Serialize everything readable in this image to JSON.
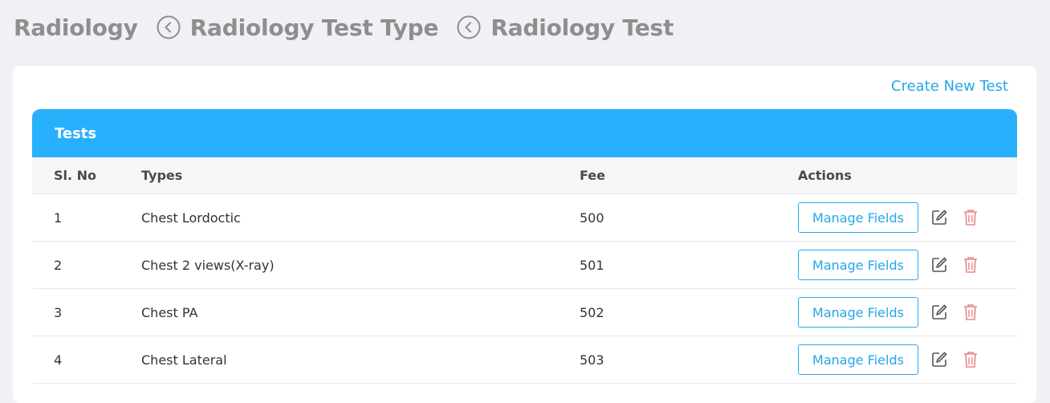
{
  "breadcrumb": {
    "items": [
      {
        "label": "Radiology"
      },
      {
        "label": "Radiology Test Type"
      },
      {
        "label": "Radiology Test"
      }
    ]
  },
  "actions": {
    "create_label": "Create New Test"
  },
  "table": {
    "title": "Tests",
    "columns": [
      "Sl. No",
      "Types",
      "Fee",
      "Actions"
    ],
    "rows": [
      {
        "sl": "1",
        "type": "Chest Lordoctic",
        "fee": "500",
        "manage_label": "Manage Fields"
      },
      {
        "sl": "2",
        "type": "Chest 2 views(X-ray)",
        "fee": "501",
        "manage_label": "Manage Fields"
      },
      {
        "sl": "3",
        "type": "Chest PA",
        "fee": "502",
        "manage_label": "Manage Fields"
      },
      {
        "sl": "4",
        "type": "Chest Lateral",
        "fee": "503",
        "manage_label": "Manage Fields"
      }
    ]
  },
  "icons": {
    "back": "chevron-left-circle-icon",
    "edit": "edit-icon",
    "delete": "trash-icon"
  },
  "colors": {
    "accent": "#29b0fc",
    "link": "#24a7e6",
    "delete": "#e8868c",
    "muted": "#8e8e8e"
  }
}
